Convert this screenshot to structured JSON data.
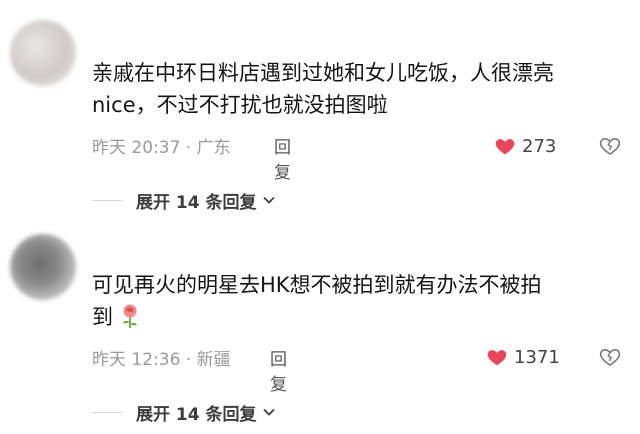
{
  "comments": [
    {
      "text_line1": "亲戚在中环日料店遇到过她和女儿吃饭，人很漂亮",
      "text_line2": "nice，不过不打扰也就没拍图啦",
      "time": "昨天 20:37 · 广东",
      "reply_label": "回复",
      "like_count": "273",
      "expand_label": "展开 14 条回复"
    },
    {
      "text_line1": "可见再火的明星去HK想不被拍到就有办法不被拍",
      "text_line2": "到",
      "time": "昨天 12:36 · 新疆",
      "reply_label": "回复",
      "like_count": "1371",
      "expand_label": "展开 14 条回复"
    }
  ],
  "colors": {
    "like_red": "#e8465a",
    "muted": "#9a9a9a"
  },
  "icons": {
    "like": "heart-icon",
    "dislike": "broken-heart-icon",
    "expand": "chevron-down-icon",
    "emoji": "rose-emoji"
  }
}
